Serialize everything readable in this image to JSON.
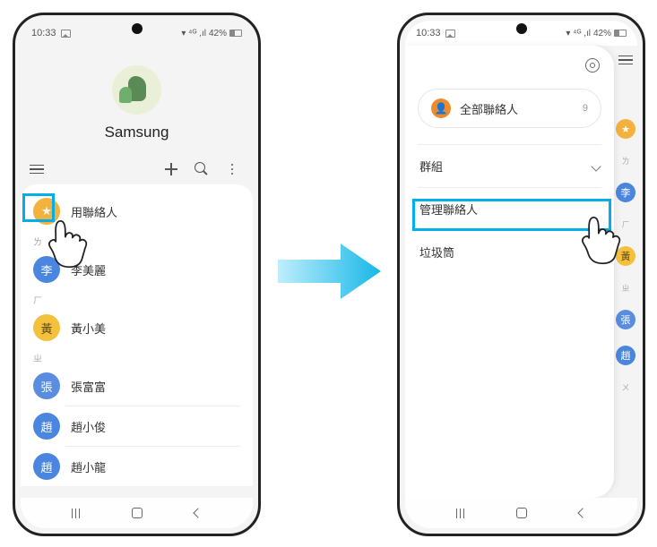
{
  "status": {
    "time": "10:33",
    "battery": "42%",
    "signal_label": "▾ ⁴ᴳ ,ıl"
  },
  "left": {
    "profile_name": "Samsung",
    "favorites_header_hidden": "",
    "contacts": [
      {
        "section": null,
        "badge": "★",
        "name": "用聯絡人",
        "color": "c-star"
      },
      {
        "section": "ㄌ",
        "badge": "李",
        "name": "李美麗",
        "color": "c-blue"
      },
      {
        "section": "ㄏ",
        "badge": "黃",
        "name": "黃小美",
        "color": "c-yellow"
      },
      {
        "section": "ㄓ",
        "badge": "張",
        "name": "張富富",
        "color": "c-blue2"
      },
      {
        "section": null,
        "badge": "趙",
        "name": "趙小俊",
        "color": "c-blue"
      },
      {
        "section": null,
        "badge": "趙",
        "name": "趙小龍",
        "color": "c-blue"
      }
    ]
  },
  "right": {
    "all_contacts_label": "全部聯絡人",
    "all_contacts_count": "9",
    "rows": {
      "groups": "群組",
      "manage": "管理聯絡人",
      "trash": "垃圾筒"
    },
    "strip": {
      "s1": "ㄌ",
      "s2": "ㄏ",
      "s3": "ㄓ",
      "b1": "李",
      "b2": "黃",
      "b3": "張",
      "b4": "趙",
      "last": "ㄨ"
    }
  }
}
